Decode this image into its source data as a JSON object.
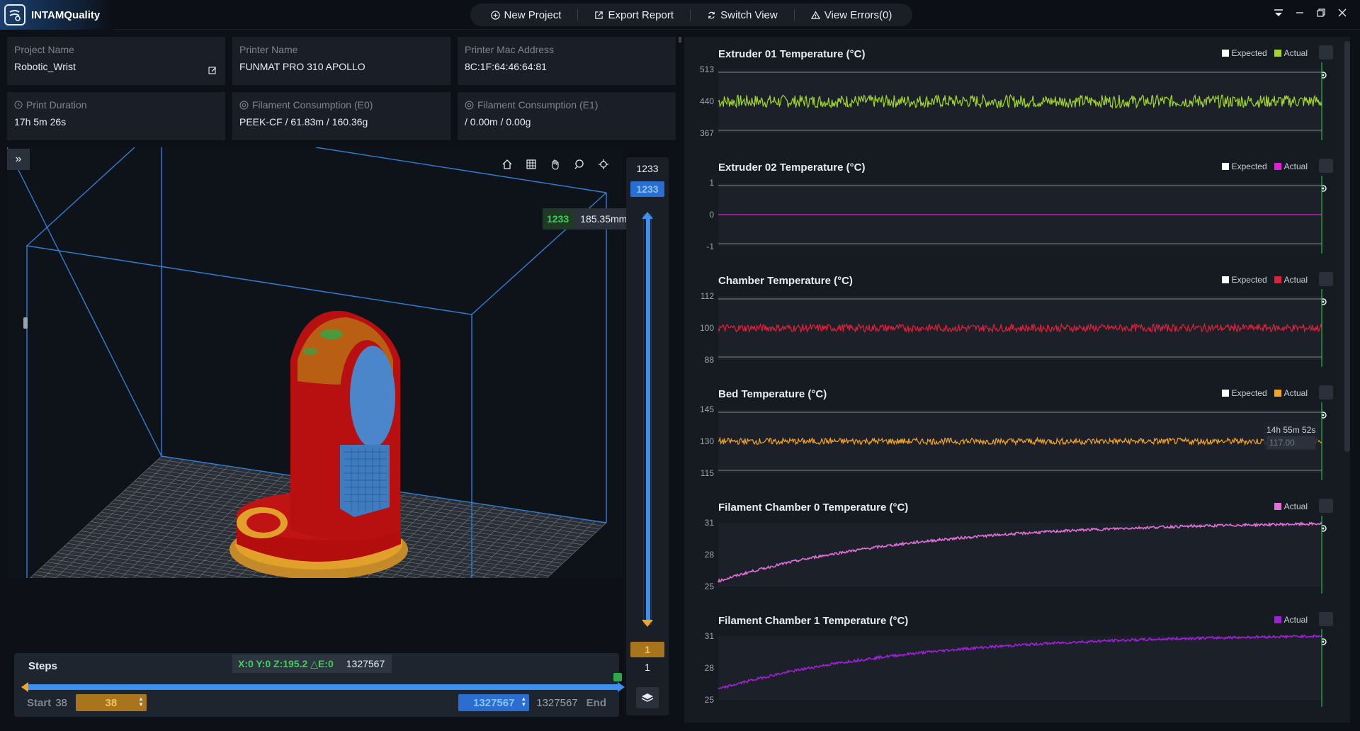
{
  "app": {
    "name": "INTAMQuality"
  },
  "toolbar": {
    "new_project": "New Project",
    "export_report": "Export Report",
    "switch_view": "Switch View",
    "view_errors": "View Errors(0)"
  },
  "info": {
    "project_name_label": "Project Name",
    "project_name": "Robotic_Wrist",
    "printer_name_label": "Printer Name",
    "printer_name": "FUNMAT PRO 310 APOLLO",
    "mac_label": "Printer Mac Address",
    "mac": "8C:1F:64:46:64:81",
    "duration_label": "Print Duration",
    "duration": "17h 5m 26s",
    "fil_e0_label": "Filament Consumption (E0)",
    "fil_e0": "PEEK-CF / 61.83m / 160.36g",
    "fil_e1_label": "Filament Consumption (E1)",
    "fil_e1": "/ 0.00m / 0.00g"
  },
  "viewport": {
    "layer_num": "1233",
    "layer_height": "185.35mm"
  },
  "layer_slider": {
    "top_value": "1233",
    "top_input": "1233",
    "bottom_input": "1",
    "bottom_value": "1",
    "max": 1233,
    "upper": 1233,
    "lower": 1
  },
  "steps": {
    "title": "Steps",
    "coords": "X:0 Y:0 Z:195.2 △E:0",
    "coords_step": "1327567",
    "start_label": "Start",
    "start_value": "38",
    "start_input": "38",
    "end_input": "1327567",
    "end_value": "1327567",
    "end_label": "End"
  },
  "legend": {
    "expected": "Expected",
    "actual": "Actual"
  },
  "colors": {
    "extruder01": "#a3d62a",
    "extruder02": "#e020d8",
    "chamber": "#e0203a",
    "bed": "#f5a524",
    "fil0": "#e070d8",
    "fil1": "#a020d8",
    "accent": "#3d8ff0"
  },
  "charts": [
    {
      "title": "Extruder 01 Temperature (°C)",
      "yticks": [
        "513",
        "440",
        "367"
      ],
      "show_expected": true,
      "series_color": "#a3d62a",
      "nominal": 440,
      "ymin": 367,
      "ymax": 513,
      "noise": 0.1,
      "shape": "flat"
    },
    {
      "title": "Extruder 02 Temperature (°C)",
      "yticks": [
        "1",
        "0",
        "-1"
      ],
      "show_expected": true,
      "series_color": "#e020d8",
      "nominal": 0,
      "ymin": -1,
      "ymax": 1,
      "noise": 0.0,
      "shape": "flat"
    },
    {
      "title": "Chamber Temperature (°C)",
      "yticks": [
        "112",
        "100",
        "88"
      ],
      "show_expected": true,
      "series_color": "#e0203a",
      "nominal": 100,
      "ymin": 88,
      "ymax": 112,
      "noise": 0.06,
      "shape": "flat"
    },
    {
      "title": "Bed Temperature (°C)",
      "yticks": [
        "145",
        "130",
        "115"
      ],
      "show_expected": true,
      "series_color": "#f5a524",
      "nominal": 130,
      "ymin": 115,
      "ymax": 145,
      "noise": 0.05,
      "shape": "flat",
      "tooltip_time": "14h 55m 52s",
      "tooltip_value": "117.00"
    },
    {
      "title": "Filament Chamber 0 Temperature (°C)",
      "yticks": [
        "31",
        "28",
        "25"
      ],
      "show_expected": false,
      "series_color": "#e070d8",
      "start": 25.5,
      "end": 30.9,
      "ymin": 25,
      "ymax": 31,
      "noise": 0.02,
      "shape": "rise"
    },
    {
      "title": "Filament Chamber 1 Temperature (°C)",
      "yticks": [
        "31",
        "28",
        "25"
      ],
      "show_expected": false,
      "series_color": "#a020d8",
      "start": 26.0,
      "end": 31.0,
      "ymin": 25,
      "ymax": 31,
      "noise": 0.02,
      "shape": "rise"
    }
  ]
}
